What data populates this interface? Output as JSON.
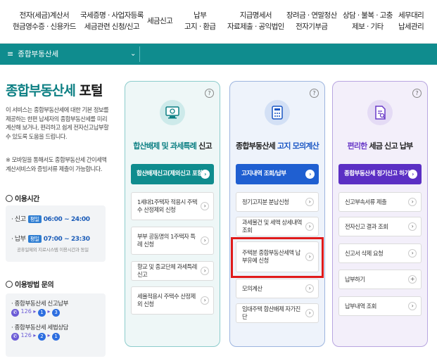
{
  "nav": [
    {
      "l1": "전자(세금)계산서",
      "l2": "현금영수증 · 신용카드"
    },
    {
      "l1": "국세증명 · 사업자등록",
      "l2": "세금관련 신청/신고"
    },
    {
      "l1": "세금신고",
      "l2": ""
    },
    {
      "l1": "납부",
      "l2": "고지 · 환급"
    },
    {
      "l1": "지급명세서",
      "l2": "자료제출 · 공익법인"
    },
    {
      "l1": "장려금 · 연말정산",
      "l2": "전자기부금"
    },
    {
      "l1": "상담 · 불복 · 고충",
      "l2": "제보 · 기타"
    },
    {
      "l1": "세무대리",
      "l2": "납세관리"
    }
  ],
  "ribbon": {
    "menu_label": "종합부동산세"
  },
  "left": {
    "title_main": "종합부동산세",
    "title_suffix": " 포털",
    "intro": "이 서비스는 종합부동산세에 대한 기본 정보를 제공하는 한편 납세자의 종합부동산세를 미리 계산해 보거나, 편리하고 쉽게 전자신고납부할 수 있도록 도움을 드립니다.",
    "intro2": "※ 모바일을 통해서도 종합부동산세 간이세액계산서비스와 증빙서류 제출이 가능합니다.",
    "hours_title": "이용시간",
    "hours": [
      {
        "label": "· 신고",
        "badge": "평일",
        "time": "06:00 ~ 24:00"
      },
      {
        "label": "· 납부",
        "badge": "평일",
        "time": "07:00 ~ 23:30"
      }
    ],
    "hours_note": "공휴일제외 지로시스템 이용시간과 동일",
    "inq_title": "이용방법 문의",
    "inquiries": [
      {
        "label": "· 종합부동산세 신고납부",
        "phone": "126",
        "d1": "1",
        "d2": "3"
      },
      {
        "label": "· 종합부동산세 세법상담",
        "phone": "126",
        "d1": "2",
        "d2": "1"
      }
    ]
  },
  "cards": [
    {
      "title_hl": "합산배제 및 과세특례",
      "title_rest": " 신고",
      "primary": "합산배제신고(제외신고 포함)",
      "items": [
        "1세대1주택자 적용시 주택수 산정제외 신청",
        "부부 공동명의 1주택자 특례 신청",
        "향교 및 종교단체 과세특례 신고",
        "세율적용시 주택수 산정제외 신청"
      ]
    },
    {
      "title_pre": "종합부동산세 ",
      "title_hl": "고지 모의계산",
      "primary": "고지내역 조회/납부",
      "items": [
        "정기고지분 분납신청",
        "과세물건 및 세액 상세내역 조회",
        "주택분 종합부동산세액 납부유예 신청",
        "모의계산",
        "임대주택 합산배제 자가진단"
      ]
    },
    {
      "title_hl": "편리한",
      "title_rest": " 세금 신고 납부",
      "primary": "종합부동산세 정기신고 하기",
      "items": [
        "신고부속서류 제출",
        "전자신고 결과 조회",
        "신고서 삭제 요청",
        "납부하기",
        "납부내역 조회"
      ],
      "item_arrows": [
        "›",
        "›",
        "›",
        "+",
        "›"
      ]
    }
  ],
  "help_glyph": "?",
  "arrow_glyph": "›",
  "colors": {
    "teal": "#0f8c8e",
    "blue": "#1f5fd1",
    "purple": "#5b2fc4",
    "highlight": "#e01a1a"
  }
}
